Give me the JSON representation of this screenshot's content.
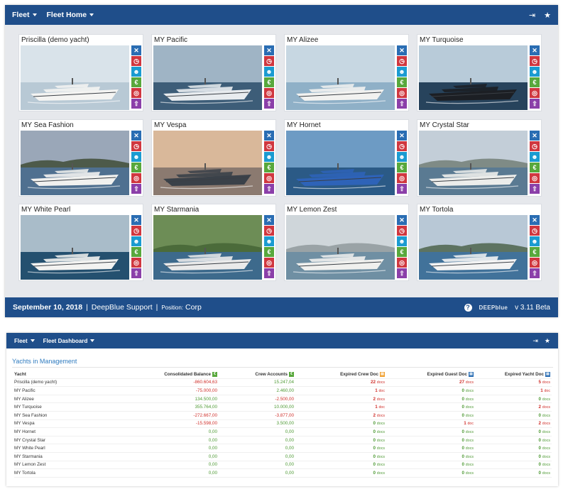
{
  "top_nav": {
    "menu1": "Fleet",
    "menu2": "Fleet Home"
  },
  "cards": [
    {
      "name": "Priscilla (demo yacht)"
    },
    {
      "name": "MY Pacific"
    },
    {
      "name": "MY Alizee"
    },
    {
      "name": "MY Turquoise"
    },
    {
      "name": "MY Sea Fashion"
    },
    {
      "name": "MY Vespa"
    },
    {
      "name": "MY Hornet"
    },
    {
      "name": "MY Crystal Star"
    },
    {
      "name": "MY White Pearl"
    },
    {
      "name": "MY Starmania"
    },
    {
      "name": "MY Lemon Zest"
    },
    {
      "name": "MY Tortola"
    }
  ],
  "card_icons": [
    {
      "name": "tools-icon",
      "glyph": "✕",
      "color": "#2a6db3"
    },
    {
      "name": "clock-icon",
      "glyph": "◷",
      "color": "#d0373f"
    },
    {
      "name": "crew-icon",
      "glyph": "☻",
      "color": "#1b9bd1"
    },
    {
      "name": "euro-icon",
      "glyph": "€",
      "color": "#58a83c"
    },
    {
      "name": "lifebuoy-icon",
      "glyph": "◎",
      "color": "#d0373f"
    },
    {
      "name": "upload-icon",
      "glyph": "⇧",
      "color": "#8b3fa9"
    }
  ],
  "footer": {
    "date": "September 10, 2018",
    "sep1": "|",
    "support": "DeepBlue Support",
    "sep2": "|",
    "position_label": "Position:",
    "position_value": "Corp",
    "help": "?",
    "logo_text": "DEEPblue",
    "version": "v 3.11 Beta"
  },
  "dashboard_nav": {
    "menu1": "Fleet",
    "menu2": "Fleet Dashboard"
  },
  "dashboard": {
    "title": "Yachts in Management",
    "columns": [
      "Yacht",
      "Consolidated Balance",
      "Crew Accounts",
      "Expired Crew Doc",
      "Expired Guest Doc",
      "Expired Yacht Doc"
    ],
    "column_badges": [
      {
        "glyph": "€",
        "color": "#58a83c"
      },
      {
        "glyph": "€",
        "color": "#58a83c"
      },
      {
        "glyph": "▤",
        "color": "#f0a030"
      },
      {
        "glyph": "▤",
        "color": "#2a6db3"
      },
      {
        "glyph": "▤",
        "color": "#2a6db3"
      }
    ],
    "unit_doc": "doc",
    "unit_docs": "docs",
    "rows": [
      {
        "yacht": "Priscilla (demo yacht)",
        "balance": "-860.604,63",
        "crew": "15.247,04",
        "crew_doc": "22",
        "crew_unit": "docs",
        "guest_doc": "27",
        "guest_unit": "docs",
        "yacht_doc": "5",
        "yacht_unit": "docs"
      },
      {
        "yacht": "MY Pacific",
        "balance": "-75.000,00",
        "crew": "2.460,00",
        "crew_doc": "1",
        "crew_unit": "doc",
        "guest_doc": "0",
        "guest_unit": "docs",
        "yacht_doc": "1",
        "yacht_unit": "doc"
      },
      {
        "yacht": "MY Alizee",
        "balance": "134.500,00",
        "crew": "-2.500,00",
        "crew_doc": "2",
        "crew_unit": "docs",
        "guest_doc": "0",
        "guest_unit": "docs",
        "yacht_doc": "0",
        "yacht_unit": "docs"
      },
      {
        "yacht": "MY Turquoise",
        "balance": "355.764,00",
        "crew": "10.000,00",
        "crew_doc": "1",
        "crew_unit": "doc",
        "guest_doc": "0",
        "guest_unit": "docs",
        "yacht_doc": "2",
        "yacht_unit": "docs"
      },
      {
        "yacht": "MY Sea Fashion",
        "balance": "-272.667,00",
        "crew": "-3.877,00",
        "crew_doc": "2",
        "crew_unit": "docs",
        "guest_doc": "0",
        "guest_unit": "docs",
        "yacht_doc": "0",
        "yacht_unit": "docs"
      },
      {
        "yacht": "MY Vespa",
        "balance": "-15.598,00",
        "crew": "3.500,00",
        "crew_doc": "0",
        "crew_unit": "docs",
        "guest_doc": "1",
        "guest_unit": "doc",
        "yacht_doc": "2",
        "yacht_unit": "docs"
      },
      {
        "yacht": "MY Hornet",
        "balance": "0,00",
        "crew": "0,00",
        "crew_doc": "0",
        "crew_unit": "docs",
        "guest_doc": "0",
        "guest_unit": "docs",
        "yacht_doc": "0",
        "yacht_unit": "docs"
      },
      {
        "yacht": "MY Crystal Star",
        "balance": "0,00",
        "crew": "0,00",
        "crew_doc": "0",
        "crew_unit": "docs",
        "guest_doc": "0",
        "guest_unit": "docs",
        "yacht_doc": "0",
        "yacht_unit": "docs"
      },
      {
        "yacht": "MY White Pearl",
        "balance": "0,00",
        "crew": "0,00",
        "crew_doc": "0",
        "crew_unit": "docs",
        "guest_doc": "0",
        "guest_unit": "docs",
        "yacht_doc": "0",
        "yacht_unit": "docs"
      },
      {
        "yacht": "MY Starmania",
        "balance": "0,00",
        "crew": "0,00",
        "crew_doc": "0",
        "crew_unit": "docs",
        "guest_doc": "0",
        "guest_unit": "docs",
        "yacht_doc": "0",
        "yacht_unit": "docs"
      },
      {
        "yacht": "MY Lemon Zest",
        "balance": "0,00",
        "crew": "0,00",
        "crew_doc": "0",
        "crew_unit": "docs",
        "guest_doc": "0",
        "guest_unit": "docs",
        "yacht_doc": "0",
        "yacht_unit": "docs"
      },
      {
        "yacht": "MY Tortola",
        "balance": "0,00",
        "crew": "0,00",
        "crew_doc": "0",
        "crew_unit": "docs",
        "guest_doc": "0",
        "guest_unit": "docs",
        "yacht_doc": "0",
        "yacht_unit": "docs"
      }
    ]
  },
  "colors": {
    "brand": "#1f4e8a",
    "negative": "#d0302b",
    "positive": "#4f9a35",
    "link": "#2f7bbf"
  }
}
